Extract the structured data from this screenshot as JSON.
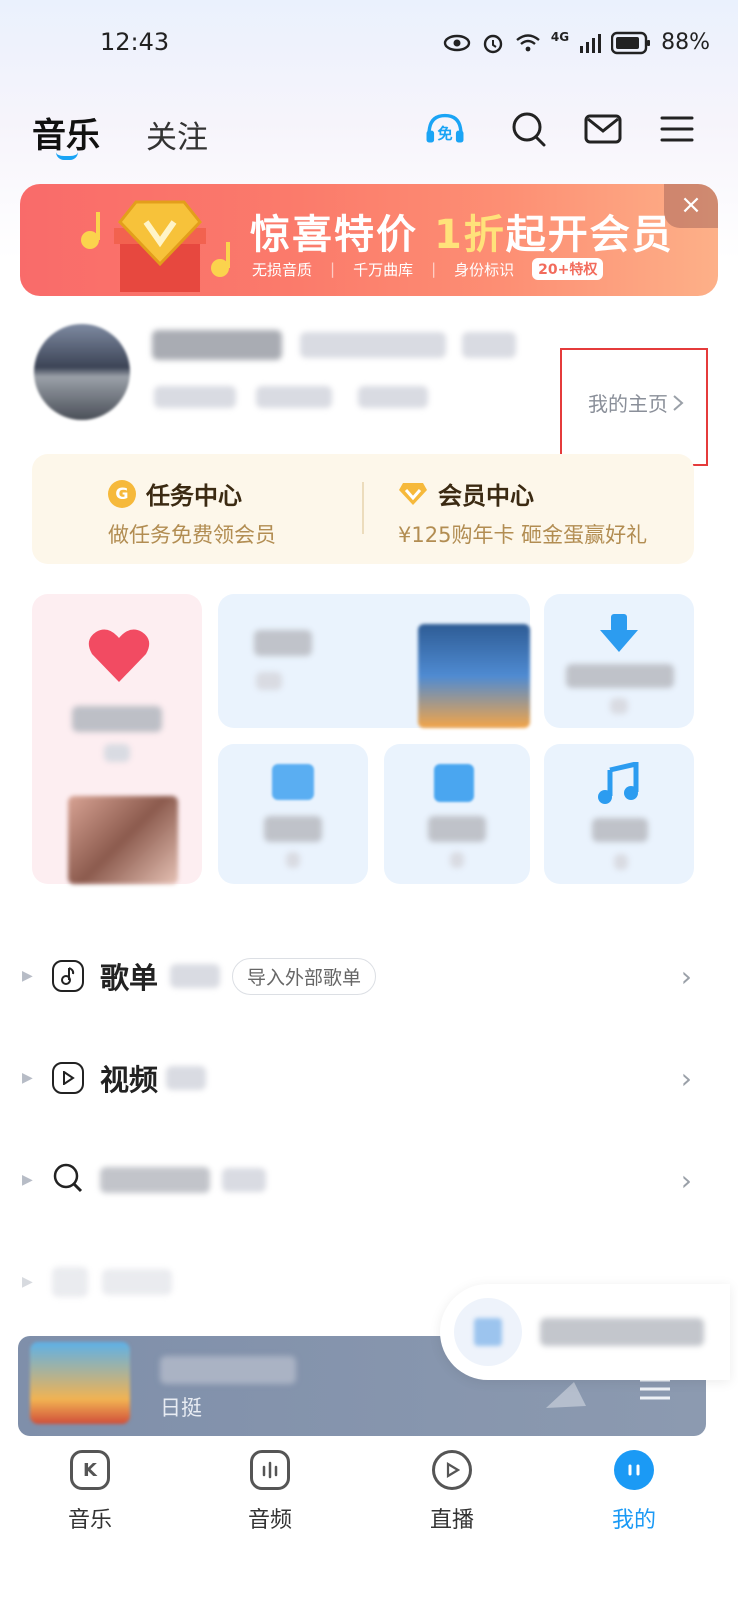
{
  "status_bar": {
    "time": "12:43",
    "network": "4G",
    "battery": "88%"
  },
  "header": {
    "tabs": [
      {
        "label": "音乐",
        "active": true
      },
      {
        "label": "关注",
        "active": false
      }
    ],
    "free_badge": "免",
    "icons": [
      "free-listen-icon",
      "search-icon",
      "mail-icon",
      "menu-icon"
    ]
  },
  "banner": {
    "title_a": "惊喜特价 ",
    "title_b": "1折",
    "title_c": "起开会员",
    "features": [
      "无损音质",
      "千万曲库",
      "身份标识"
    ],
    "badge": "20+特权",
    "close": "×"
  },
  "profile": {
    "my_home": "我的主页"
  },
  "task_center": {
    "title": "任务中心",
    "subtitle": "做任务免费领会员"
  },
  "member_center": {
    "title": "会员中心",
    "subtitle": "¥125购年卡 砸金蛋赢好礼"
  },
  "lists": [
    {
      "label": "歌单",
      "action": "导入外部歌单"
    },
    {
      "label": "视频",
      "action": ""
    }
  ],
  "player": {
    "artist": "日挺"
  },
  "bottom_nav": [
    {
      "label": "音乐",
      "icon": "K"
    },
    {
      "label": "音频",
      "icon": "audio-icon"
    },
    {
      "label": "直播",
      "icon": "live-icon"
    },
    {
      "label": "我的",
      "icon": "mine-icon",
      "active": true
    }
  ],
  "colors": {
    "accent": "#1b9af5",
    "banner": "#f96b6a",
    "member_gold": "#b28d52",
    "highlight_frame": "#e53b3b"
  }
}
